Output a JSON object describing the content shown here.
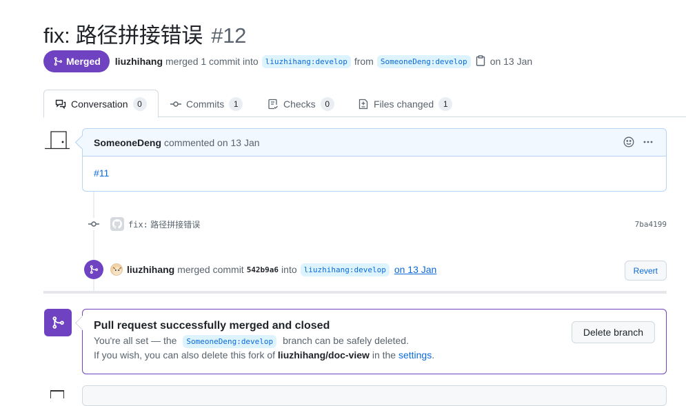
{
  "pr": {
    "title": "fix: 路径拼接错误",
    "number": "#12",
    "state_label": "Merged",
    "author": "liuzhihang",
    "meta_text": "merged 1 commit into",
    "base_branch": "liuzhihang:develop",
    "from_text": "from",
    "head_branch": "SomeoneDeng:develop",
    "date_text": "on 13 Jan"
  },
  "tabs": [
    {
      "label": "Conversation",
      "count": "0",
      "icon": "comment-discussion-icon",
      "active": true
    },
    {
      "label": "Commits",
      "count": "1",
      "icon": "git-commit-icon",
      "active": false
    },
    {
      "label": "Checks",
      "count": "0",
      "icon": "checklist-icon",
      "active": false
    },
    {
      "label": "Files changed",
      "count": "1",
      "icon": "file-diff-icon",
      "active": false
    }
  ],
  "comment": {
    "author": "SomeoneDeng",
    "action": "commented on 13 Jan",
    "body_link": "#11"
  },
  "commit": {
    "message_prefix": "fix:",
    "message": "路径拼接错误",
    "sha": "7ba4199"
  },
  "merge_event": {
    "user": "liuzhihang",
    "action": "merged commit",
    "sha": "542b9a6",
    "into": "into",
    "branch": "liuzhihang:develop",
    "date_link": "on 13 Jan",
    "revert_label": "Revert"
  },
  "merged_box": {
    "title": "Pull request successfully merged and closed",
    "line1_prefix": "You're all set — the",
    "line1_branch": "SomeoneDeng:develop",
    "line1_suffix": "branch can be safely deleted.",
    "line2_prefix": "If you wish, you can also delete this fork of",
    "line2_repo": "liuzhihang/doc-view",
    "line2_mid": "in the",
    "line2_link": "settings",
    "line2_end": ".",
    "delete_label": "Delete branch"
  },
  "colors": {
    "merged_purple": "#6f42c1",
    "link_blue": "#0969da"
  }
}
